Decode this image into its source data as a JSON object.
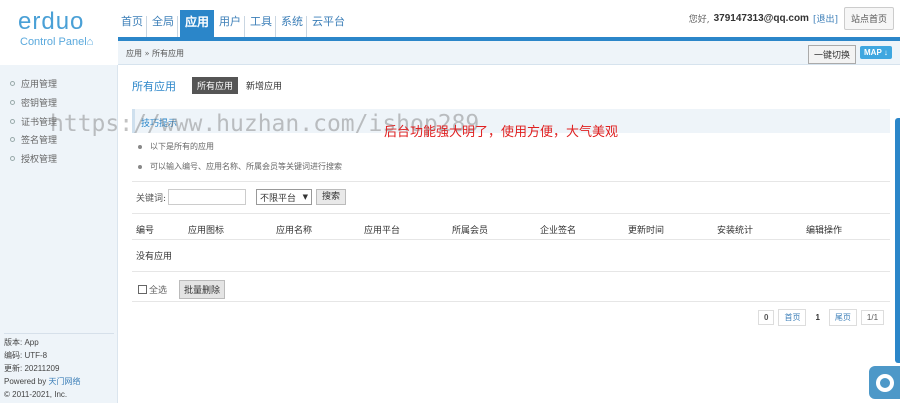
{
  "logo": {
    "brand": "erduo",
    "subtitle": "Control Panel",
    "sub_icon": "home-icon"
  },
  "topnav": {
    "items": [
      {
        "label": "首页",
        "active": false
      },
      {
        "label": "全局",
        "active": false
      },
      {
        "label": "应用",
        "active": true
      },
      {
        "label": "用户",
        "active": false
      },
      {
        "label": "工具",
        "active": false
      },
      {
        "label": "系统",
        "active": false
      },
      {
        "label": "云平台",
        "active": false
      }
    ]
  },
  "header": {
    "greeting": "您好,",
    "email": "379147313@qq.com",
    "logout": "[退出]",
    "home_button": "站点首页"
  },
  "subbar": {
    "breadcrumb": "应用 » 所有应用",
    "switch_button": "一键切换",
    "map_button": "MAP ↓"
  },
  "sidebar": {
    "items": [
      {
        "label": "应用管理"
      },
      {
        "label": "密钥管理"
      },
      {
        "label": "证书管理"
      },
      {
        "label": "签名管理"
      },
      {
        "label": "授权管理"
      }
    ],
    "footer": {
      "version": "版本: App",
      "encoding": "编码: UTF-8",
      "updated": "更新: 20211209",
      "powered_prefix": "Powered by ",
      "powered_link": "天门网络",
      "copyright": "© 2011-2021, Inc."
    }
  },
  "main": {
    "title": "所有应用",
    "tabs": [
      {
        "label": "所有应用",
        "active": true
      },
      {
        "label": "新增应用",
        "active": false
      }
    ],
    "tips": {
      "title": "技巧提示",
      "lines": [
        "以下是所有的应用",
        "可以输入编号、应用名称、所属会员等关键词进行搜索"
      ]
    },
    "watermark": "https://www.huzhan.com/ishop289",
    "promo": "后台功能强大明了，使用方便，大气美观",
    "search": {
      "label": "关键词:",
      "value": "",
      "platform_selected": "不限平台",
      "button": "搜索"
    },
    "table": {
      "headers": [
        "编号",
        "应用图标",
        "应用名称",
        "应用平台",
        "所属会员",
        "企业签名",
        "更新时间",
        "安装统计",
        "编辑操作"
      ],
      "empty_text": "没有应用"
    },
    "batch": {
      "select_all": "全选",
      "delete_button": "批量删除"
    },
    "pager": {
      "total": "0",
      "first": "首页",
      "current": "1",
      "last": "尾页",
      "info": "1/1"
    }
  },
  "colors": {
    "accent": "#2b86c9",
    "sidebar_bg": "#eef4f9",
    "promo": "#e02020"
  }
}
